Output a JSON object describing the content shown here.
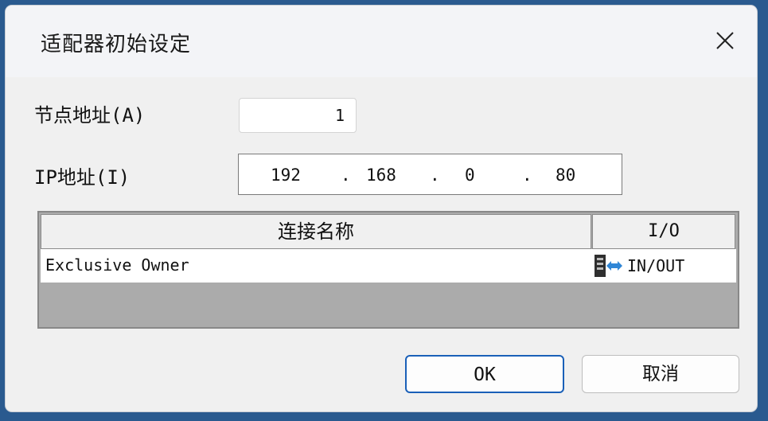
{
  "dialog": {
    "title": "适配器初始设定",
    "close_icon": "close-icon"
  },
  "form": {
    "node_address_label": "节点地址(A)",
    "node_address_value": "1",
    "ip_address_label": "IP地址(I)",
    "ip_octets": [
      "192",
      "168",
      "0",
      "80"
    ],
    "ip_separator": "."
  },
  "table": {
    "columns": [
      "连接名称",
      "I/O"
    ],
    "rows": [
      {
        "name": "Exclusive Owner",
        "io": "IN/OUT",
        "io_icon": "in-out-icon"
      }
    ]
  },
  "buttons": {
    "ok_label": "OK",
    "cancel_label": "取消"
  },
  "colors": {
    "accent": "#1a60b8",
    "window_frame": "#2a5a8f",
    "grid_empty": "#ababab"
  }
}
